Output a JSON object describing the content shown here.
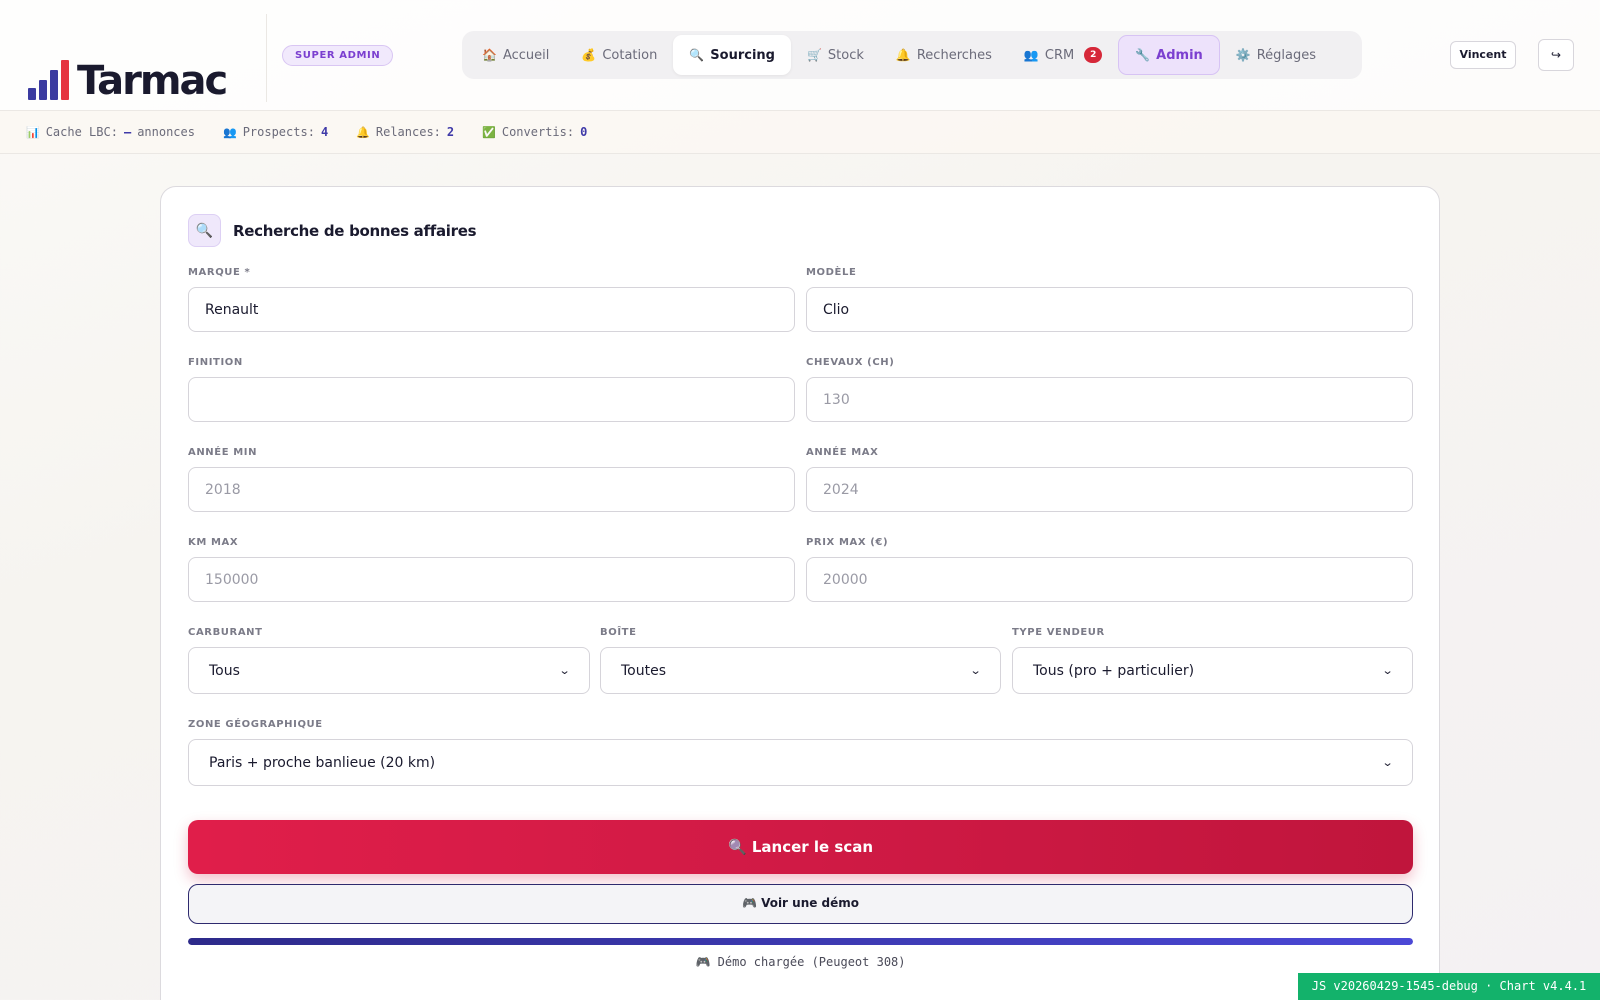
{
  "header": {
    "logo_text": "Tarmac",
    "logo_colors": [
      "#3b3ba0",
      "#3b3ba0",
      "#3b3ba0",
      "#e53340"
    ],
    "role_badge": "SUPER ADMIN",
    "user": "Vincent",
    "logout_icon": "↪"
  },
  "nav": {
    "tabs": [
      {
        "icon": "🏠",
        "label": "Accueil"
      },
      {
        "icon": "💰",
        "label": "Cotation"
      },
      {
        "icon": "🔍",
        "label": "Sourcing"
      },
      {
        "icon": "🛒",
        "label": "Stock"
      },
      {
        "icon": "🔔",
        "label": "Recherches"
      },
      {
        "icon": "👥",
        "label": "CRM",
        "badge": "2"
      },
      {
        "icon": "🔧",
        "label": "Admin"
      },
      {
        "icon": "⚙️",
        "label": "Réglages"
      }
    ],
    "active": "Sourcing"
  },
  "stats": [
    {
      "icon": "📊",
      "label": "Cache LBC:",
      "value": "—",
      "suffix": "annonces"
    },
    {
      "icon": "👥",
      "label": "Prospects:",
      "value": "4"
    },
    {
      "icon": "🔔",
      "label": "Relances:",
      "value": "2"
    },
    {
      "icon": "✅",
      "label": "Convertis:",
      "value": "0"
    }
  ],
  "search": {
    "icon": "🔍",
    "title": "Recherche de bonnes affaires",
    "marque": {
      "label": "MARQUE *",
      "value": "Renault"
    },
    "modele": {
      "label": "MODÈLE",
      "value": "Clio"
    },
    "finition": {
      "label": "FINITION",
      "value": ""
    },
    "chevaux": {
      "label": "CHEVAUX (CH)",
      "placeholder": "130"
    },
    "annee_min": {
      "label": "ANNÉE MIN",
      "placeholder": "2018"
    },
    "annee_max": {
      "label": "ANNÉE MAX",
      "placeholder": "2024"
    },
    "km_max": {
      "label": "KM MAX",
      "placeholder": "150000"
    },
    "prix_max": {
      "label": "PRIX MAX (€)",
      "placeholder": "20000"
    },
    "carburant": {
      "label": "CARBURANT",
      "selected": "Tous"
    },
    "boite": {
      "label": "BOÎTE",
      "selected": "Toutes"
    },
    "type_vendeur": {
      "label": "TYPE VENDEUR",
      "selected": "Tous (pro + particulier)"
    },
    "zone": {
      "label": "ZONE GÉOGRAPHIQUE",
      "selected": "Paris + proche banlieue (20 km)"
    }
  },
  "actions": {
    "scan_label": "🔍 Lancer le scan",
    "demo_label": "🎮 Voir une démo",
    "progress": 1.0,
    "status": "🎮 Démo chargée (Peugeot 308)"
  },
  "debug": "JS v20260429-1545-debug · Chart v4.4.1",
  "colors": {
    "accent_red": "#d01a45",
    "accent_purple": "#7b3fd0",
    "progress_blue": "#3b38b8",
    "debug_green": "#13b26b"
  }
}
